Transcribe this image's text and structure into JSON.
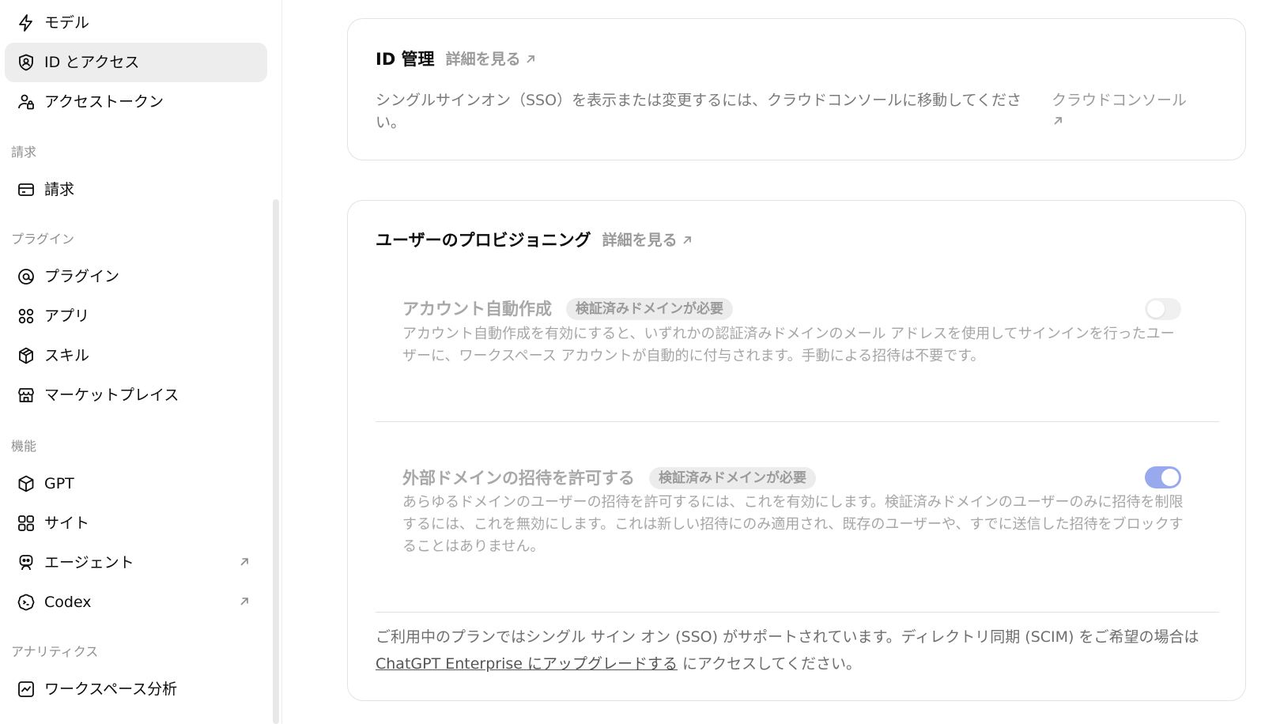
{
  "sidebar": {
    "items": [
      {
        "label": "モデル",
        "icon": "bolt-icon"
      },
      {
        "label": "ID とアクセス",
        "icon": "shield-user-icon",
        "active": true
      },
      {
        "label": "アクセストークン",
        "icon": "user-lock-icon"
      }
    ],
    "billing_section": "請求",
    "billing_items": [
      {
        "label": "請求",
        "icon": "card-icon"
      }
    ],
    "plugins_section": "プラグイン",
    "plugin_items": [
      {
        "label": "プラグイン",
        "icon": "at-icon"
      },
      {
        "label": "アプリ",
        "icon": "apps-grid-icon"
      },
      {
        "label": "スキル",
        "icon": "cube-stack-icon"
      },
      {
        "label": "マーケットプレイス",
        "icon": "store-icon"
      }
    ],
    "features_section": "機能",
    "feature_items": [
      {
        "label": "GPT",
        "icon": "box-icon"
      },
      {
        "label": "サイト",
        "icon": "site-grid-icon"
      },
      {
        "label": "エージェント",
        "icon": "robot-icon",
        "external": true
      },
      {
        "label": "Codex",
        "icon": "codex-icon",
        "external": true
      }
    ],
    "analytics_section": "アナリティクス",
    "analytics_items": [
      {
        "label": "ワークスペース分析",
        "icon": "chart-icon"
      }
    ]
  },
  "id_card": {
    "title": "ID 管理",
    "more_label": "詳細を見る",
    "description": "シングルサインオン（SSO）を表示または変更するには、クラウドコンソールに移動してください。",
    "console_link": "クラウドコンソール"
  },
  "provisioning": {
    "title": "ユーザーのプロビジョニング",
    "more_label": "詳細を見る",
    "auto_create": {
      "title": "アカウント自動作成",
      "badge": "検証済みドメインが必要",
      "description": "アカウント自動作成を有効にすると、いずれかの認証済みドメインのメール アドレスを使用してサインインを行ったユーザーに、ワークスペース アカウントが自動的に付与されます。手動による招待は不要です。",
      "enabled": false
    },
    "external_invite": {
      "title": "外部ドメインの招待を許可する",
      "badge": "検証済みドメインが必要",
      "description": "あらゆるドメインのユーザーの招待を許可するには、これを有効にします。検証済みドメインのユーザーのみに招待を制限するには、これを無効にします。これは新しい招待にのみ適用され、既存のユーザーや、すでに送信した招待をブロックすることはありません。",
      "enabled": true
    },
    "footer_prefix": "ご利用中のプランではシングル サイン オン (SSO) がサポートされています。ディレクトリ同期 (SCIM) をご希望の場合は ",
    "footer_link": "ChatGPT Enterprise にアップグレードする",
    "footer_suffix": " にアクセスしてください。"
  },
  "colors": {
    "toggle_on": "#98a9ee",
    "active_item": "#ededed"
  }
}
